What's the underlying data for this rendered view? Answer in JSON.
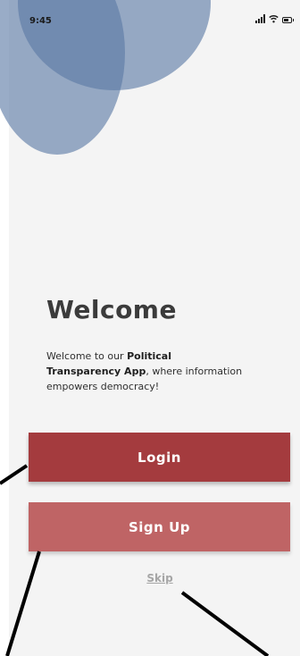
{
  "status_bar": {
    "time": "9:45",
    "icons": [
      "signal-icon",
      "wifi-icon",
      "battery-icon"
    ]
  },
  "welcome": {
    "title": "Welcome",
    "text_prefix": "Welcome to our ",
    "app_name_1": "Political",
    "app_name_2": "Transparency App",
    "text_suffix": ", where information empowers democracy!"
  },
  "buttons": {
    "login_label": "Login",
    "signup_label": "Sign Up",
    "skip_label": "Skip"
  },
  "colors": {
    "login": "#a43b3e",
    "signup": "#bf6465",
    "bubble": "#5a79a5"
  }
}
